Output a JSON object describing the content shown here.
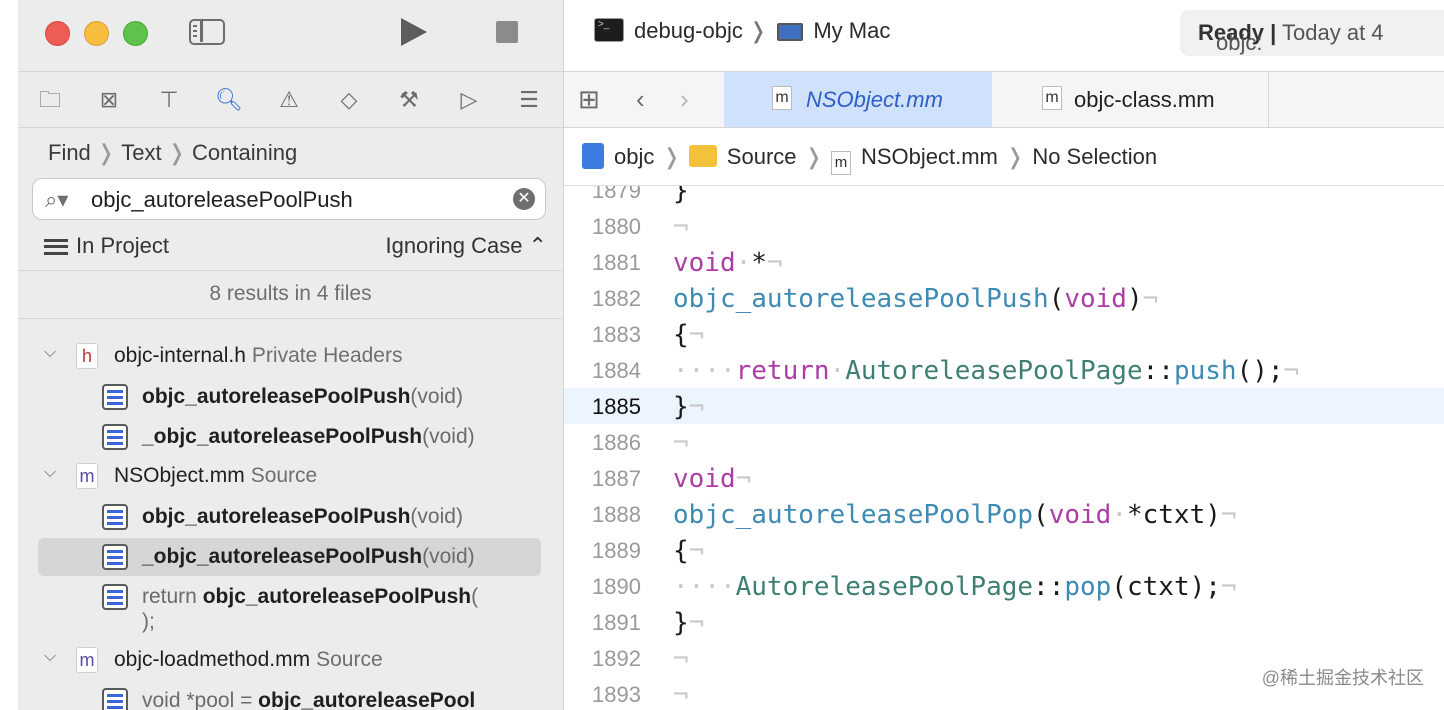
{
  "navigator": {
    "find_path": [
      "Find",
      "Text",
      "Containing"
    ],
    "search_value": "objc_autoreleasePoolPush",
    "scope": "In Project",
    "case_mode": "Ignoring Case ⌃",
    "summary": "8 results in 4 files",
    "groups": [
      {
        "file": "objc-internal.h",
        "group": "Private Headers",
        "icon": "h",
        "matches": [
          {
            "bold": "objc_autoreleasePoolPush",
            "rest": "(void)"
          },
          {
            "bold": "_objc_autoreleasePoolPush",
            "rest": "(void)"
          }
        ]
      },
      {
        "file": "NSObject.mm",
        "group": "Source",
        "icon": "m",
        "matches": [
          {
            "bold": "objc_autoreleasePoolPush",
            "rest": "(void)"
          },
          {
            "bold": "_objc_autoreleasePoolPush",
            "rest": "(void)"
          },
          {
            "pre": "return ",
            "bold": "objc_autoreleasePoolPush",
            "rest": "(",
            "line2": ");"
          }
        ]
      },
      {
        "file": "objc-loadmethod.mm",
        "group": "Source",
        "icon": "m",
        "matches": [
          {
            "pre": "void *pool = ",
            "bold": "objc_autoreleasePool",
            "rest": ""
          }
        ]
      }
    ]
  },
  "toolbar": {
    "scheme": "debug-objc",
    "destination": "My Mac",
    "status_prefix": "objc: ",
    "status_bold": "Ready |",
    "status_suffix": " Today at 4"
  },
  "tabs": [
    {
      "label": "NSObject.mm",
      "icon": "m",
      "active": true
    },
    {
      "label": "objc-class.mm",
      "icon": "m",
      "active": false
    }
  ],
  "jumpbar": {
    "project": "objc",
    "folder": "Source",
    "file": "NSObject.mm",
    "selection": "No Selection"
  },
  "code_lines": [
    {
      "n": "1879",
      "html": "}"
    },
    {
      "n": "1880",
      "html": "<span class='mk'>¬</span>"
    },
    {
      "n": "1881",
      "html": "<span class='kw'>void</span><span class='mk'>·</span>*<span class='mk'>¬</span>"
    },
    {
      "n": "1882",
      "html": "<span class='fn'>objc_autoreleasePoolPush</span>(<span class='kw'>void</span>)<span class='mk'>¬</span>"
    },
    {
      "n": "1883",
      "html": "{<span class='mk'>¬</span>"
    },
    {
      "n": "1884",
      "html": "<span class='mk'>····</span><span class='kw'>return</span><span class='mk'>·</span><span class='ty'>AutoreleasePoolPage</span>::<span class='fn'>push</span>();<span class='mk'>¬</span>"
    },
    {
      "n": "1885",
      "html": "}<span class='mk'>¬</span>",
      "current": true
    },
    {
      "n": "1886",
      "html": "<span class='mk'>¬</span>"
    },
    {
      "n": "1887",
      "html": "<span class='kw'>void</span><span class='mk'>¬</span>"
    },
    {
      "n": "1888",
      "html": "<span class='fn'>objc_autoreleasePoolPop</span>(<span class='kw'>void</span><span class='mk'>·</span>*ctxt)<span class='mk'>¬</span>"
    },
    {
      "n": "1889",
      "html": "{<span class='mk'>¬</span>"
    },
    {
      "n": "1890",
      "html": "<span class='mk'>····</span><span class='ty'>AutoreleasePoolPage</span>::<span class='fn'>pop</span>(ctxt);<span class='mk'>¬</span>"
    },
    {
      "n": "1891",
      "html": "}<span class='mk'>¬</span>"
    },
    {
      "n": "1892",
      "html": "<span class='mk'>¬</span>"
    },
    {
      "n": "1893",
      "html": "<span class='mk'>¬</span>"
    }
  ],
  "watermark": "@稀土掘金技术社区",
  "colors": {
    "keyword": "#ad3da4",
    "function": "#3d8ab5",
    "type": "#3e7f74",
    "active_tab": "#cfe1fb"
  }
}
